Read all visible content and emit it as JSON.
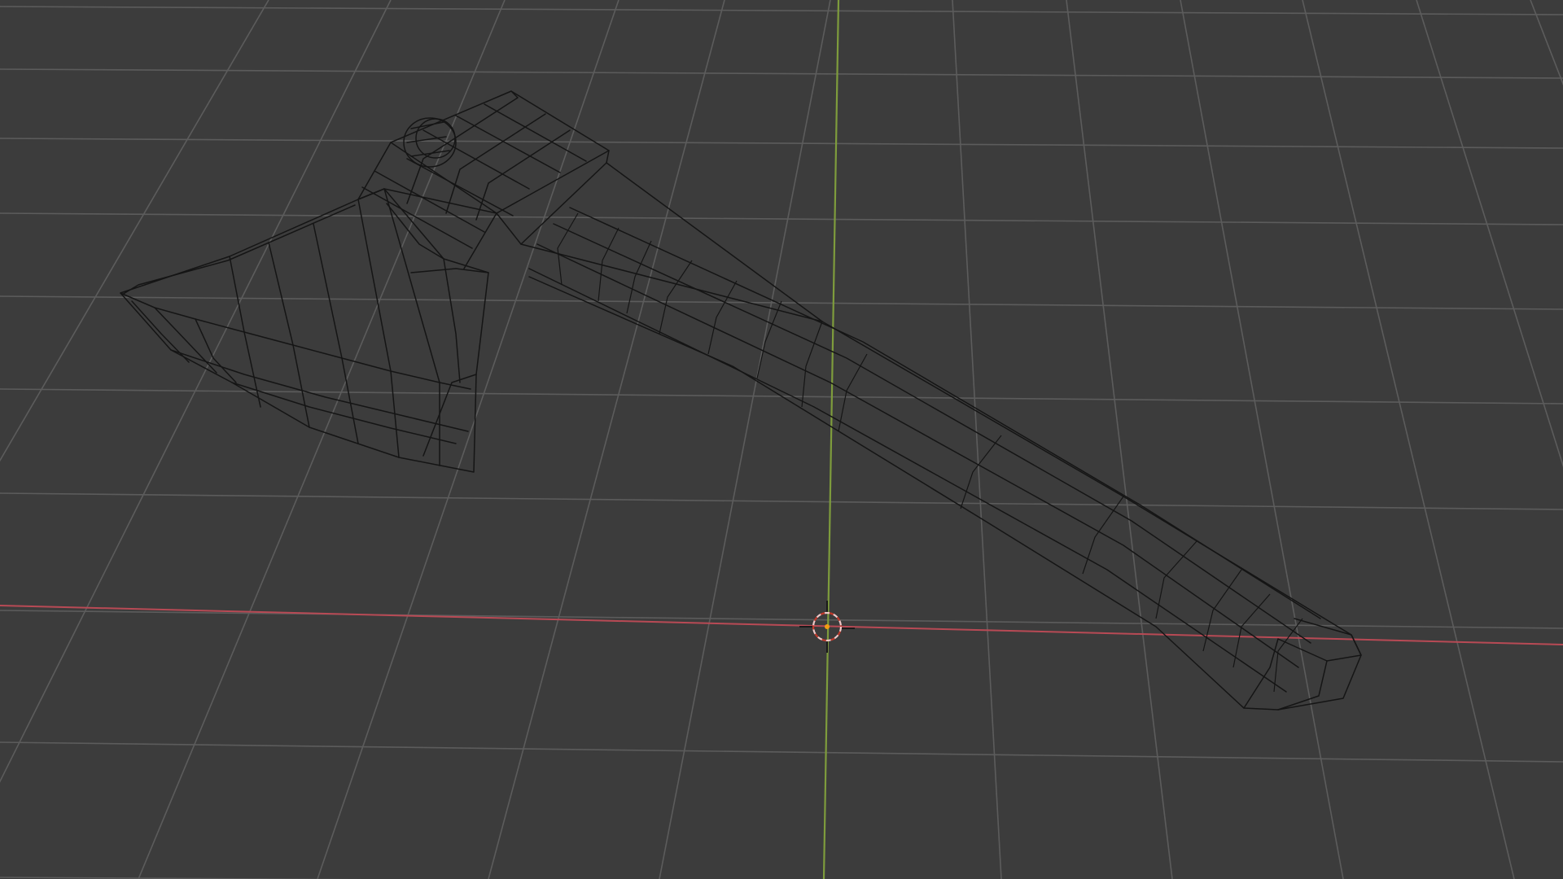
{
  "viewport": {
    "background_color": "#3c3c3c",
    "grid_color": "#5c5c5c",
    "x_axis_color": "#b84a55",
    "y_axis_color": "#7e9c3c",
    "wireframe_color": "#151515",
    "display_mode": "wireframe"
  },
  "scene": {
    "object": "axe-mesh",
    "cursor": "3d-cursor-icon",
    "origin": "object-origin-icon"
  }
}
